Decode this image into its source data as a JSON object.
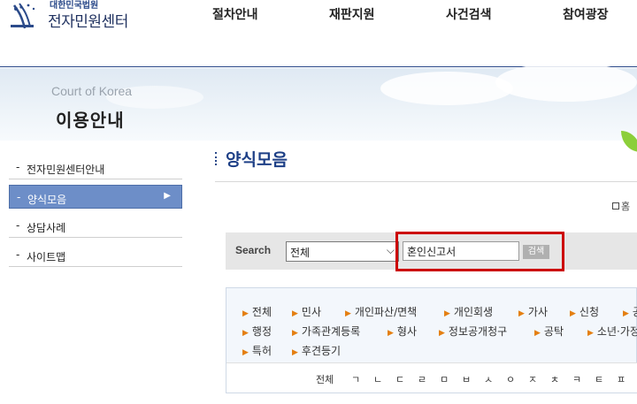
{
  "header": {
    "logo_small": "대한민국법원",
    "logo_main": "전자민원센터",
    "nav": [
      "절차안내",
      "재판지원",
      "사건검색",
      "참여광장"
    ]
  },
  "lnb": {
    "subtitle": "Court of Korea",
    "title": "이용안내",
    "items": [
      {
        "label": "전자민원센터안내",
        "active": false
      },
      {
        "label": "양식모음",
        "active": true
      },
      {
        "label": "상담사례",
        "active": false
      },
      {
        "label": "사이트맵",
        "active": false
      }
    ],
    "bullet": "-",
    "active_arrow": "▶"
  },
  "content": {
    "page_title": "양식모음",
    "home_text": "홈"
  },
  "search": {
    "label": "Search",
    "select_value": "전체",
    "input_value": "혼인신고서",
    "button_label": "검색"
  },
  "categories": {
    "row1": [
      "전체",
      "민사",
      "개인파산/면책",
      "개인회생",
      "가사",
      "신청",
      "공"
    ],
    "row2": [
      "행정",
      "가족관계등록",
      "형사",
      "정보공개청구",
      "공탁",
      "소년·가정"
    ],
    "row3": [
      "특허",
      "후견등기"
    ],
    "cho_all": "전체",
    "cho": [
      "ㄱ",
      "ㄴ",
      "ㄷ",
      "ㄹ",
      "ㅁ",
      "ㅂ",
      "ㅅ",
      "ㅇ",
      "ㅈ",
      "ㅊ",
      "ㅋ",
      "ㅌ",
      "ㅍ"
    ]
  },
  "colors": {
    "accent": "#1d3f86",
    "lnb_active": "#6d8ec8",
    "highlight": "#cc0000",
    "bullet": "#e47f12"
  }
}
